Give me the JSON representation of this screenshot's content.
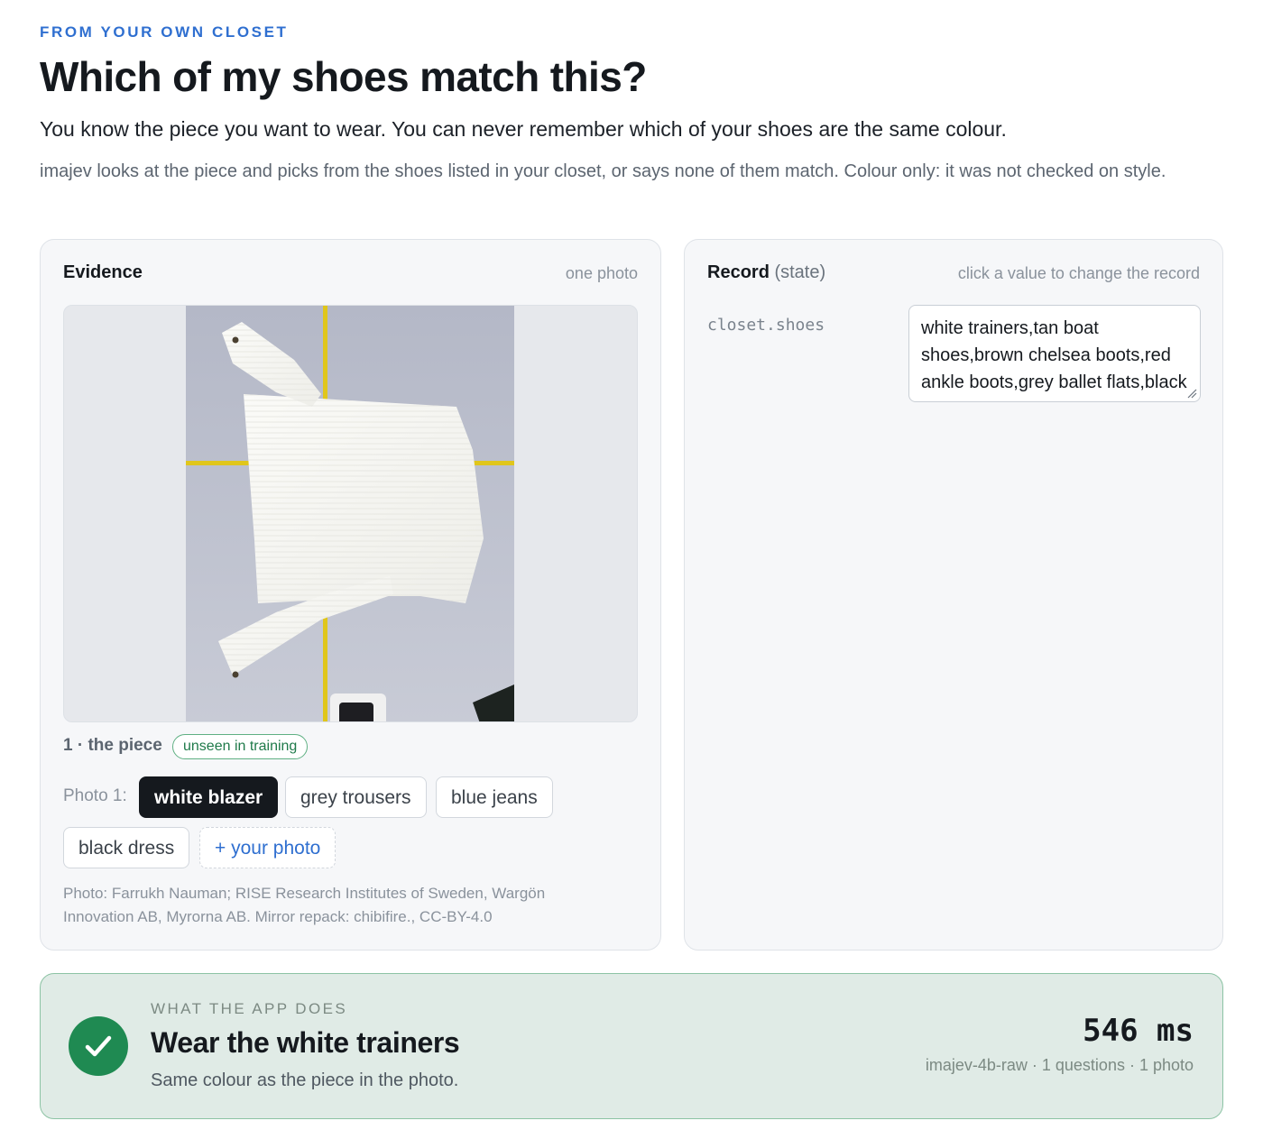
{
  "header": {
    "eyebrow": "FROM YOUR OWN CLOSET",
    "title": "Which of my shoes match this?",
    "lead": "You know the piece you want to wear. You can never remember which of your shoes are the same colour.",
    "description": "imajev looks at the piece and picks from the shoes listed in your closet, or says none of them match. Colour only: it was not checked on style."
  },
  "evidence": {
    "title": "Evidence",
    "meta": "one photo",
    "photo_caption": "1 · the piece",
    "badge": "unseen in training",
    "chip_label": "Photo 1:",
    "chips": [
      {
        "label": "white blazer",
        "selected": true
      },
      {
        "label": "grey trousers",
        "selected": false
      },
      {
        "label": "blue jeans",
        "selected": false
      },
      {
        "label": "black dress",
        "selected": false
      }
    ],
    "add_photo": "+ your photo",
    "credit": "Photo: Farrukh Nauman; RISE Research Institutes of Sweden, Wargön Innovation AB, Myrorna AB. Mirror repack: chibifire., CC-BY-4.0"
  },
  "record": {
    "title": "Record",
    "title_suffix": "(state)",
    "meta": "click a value to change the record",
    "field_key": "closet.shoes",
    "field_value": "white trainers,tan boat shoes,brown chelsea boots,red ankle boots,grey ballet flats,black court shoes"
  },
  "result": {
    "eyebrow": "WHAT THE APP DOES",
    "title": "Wear the white trainers",
    "subtitle": "Same colour as the piece in the photo.",
    "latency": "546 ms",
    "meta": "imajev-4b-raw · 1 questions · 1 photo",
    "status_icon": "check-icon",
    "status_color": "#1f8a52"
  },
  "colors": {
    "accent": "#2f6fd0",
    "success": "#1f8a52",
    "ink": "#15191e"
  }
}
